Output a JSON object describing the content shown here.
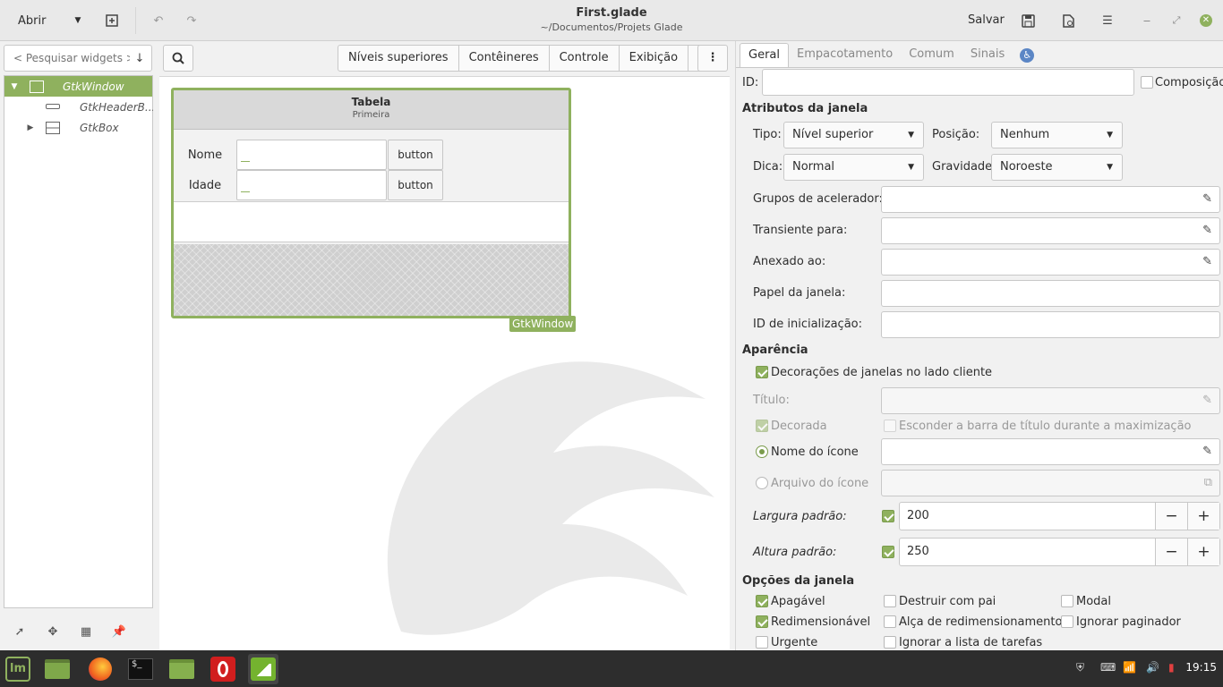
{
  "header": {
    "open_label": "Abrir",
    "title": "First.glade",
    "subtitle": "~/Documentos/Projets Glade",
    "save_label": "Salvar"
  },
  "left": {
    "search_placeholder": "< Pesquisar widgets >",
    "tree": [
      {
        "label": "GtkWindow",
        "selected": true
      },
      {
        "label": "GtkHeaderB..."
      },
      {
        "label": "GtkBox"
      }
    ]
  },
  "center": {
    "groups": [
      "Níveis superiores",
      "Contêineres",
      "Controle",
      "Exibição"
    ],
    "window": {
      "title": "Tabela",
      "subtitle": "Primeira",
      "rows": [
        {
          "label": "Nome",
          "button": "button"
        },
        {
          "label": "Idade",
          "button": "button"
        }
      ],
      "tag": "GtkWindow"
    }
  },
  "right": {
    "tabs": [
      "Geral",
      "Empacotamento",
      "Comum",
      "Sinais"
    ],
    "id_label": "ID:",
    "composition_label": "Composição",
    "window_attrs_title": "Atributos da janela",
    "type_label": "Tipo:",
    "type_value": "Nível superior",
    "position_label": "Posição:",
    "position_value": "Nenhum",
    "hint_label": "Dica:",
    "hint_value": "Normal",
    "gravity_label": "Gravidade:",
    "gravity_value": "Noroeste",
    "accel_label": "Grupos de acelerador:",
    "transient_label": "Transiente para:",
    "attached_label": "Anexado ao:",
    "role_label": "Papel da janela:",
    "startup_label": "ID de inicialização:",
    "appearance_title": "Aparência",
    "csd_label": "Decorações de janelas no lado cliente",
    "title_label": "Título:",
    "decorated_label": "Decorada",
    "hide_titlebar_label": "Esconder a barra de título durante a maximização",
    "icon_name_label": "Nome do ícone",
    "icon_file_label": "Arquivo do ícone",
    "width_label": "Largura padrão:",
    "width_value": "200",
    "height_label": "Altura padrão:",
    "height_value": "250",
    "options_title": "Opções da janela",
    "opts": {
      "deletable": "Apagável",
      "destroy_parent": "Destruir com pai",
      "modal": "Modal",
      "resizable": "Redimensionável",
      "resize_grip": "Alça de redimensionamento",
      "skip_pager": "Ignorar paginador",
      "urgent": "Urgente",
      "skip_taskbar": "Ignorar a lista de tarefas"
    }
  },
  "taskbar": {
    "clock": "19:15"
  }
}
